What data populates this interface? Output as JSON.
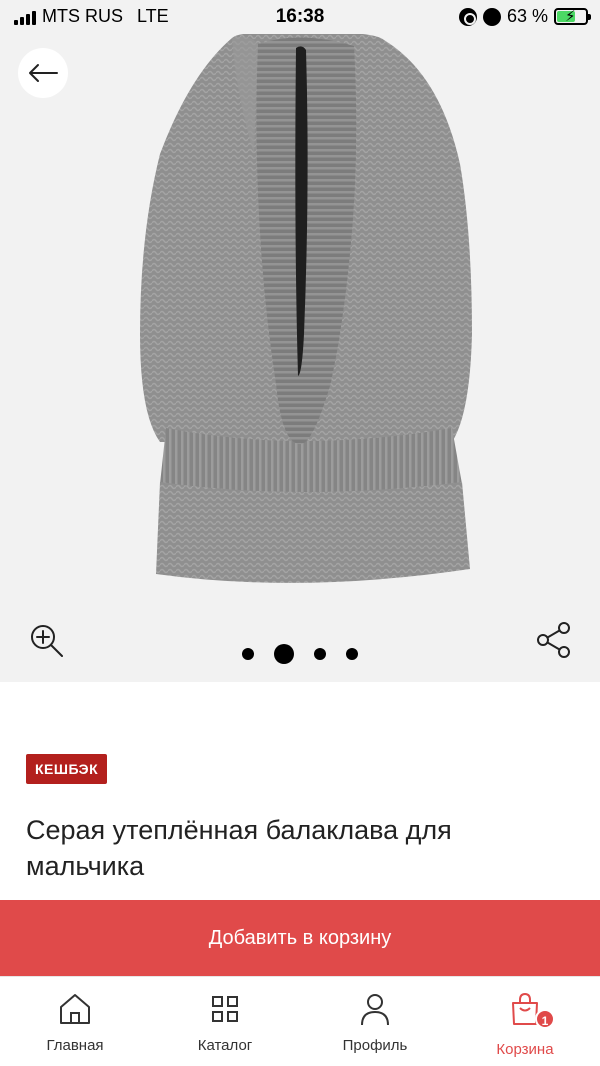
{
  "status_bar": {
    "carrier": "MTS RUS",
    "network": "LTE",
    "time": "16:38",
    "battery": "63 %",
    "battery_level": 0.63
  },
  "gallery": {
    "image_count": 4,
    "active_index": 1
  },
  "product": {
    "badge": "КЕШБЭК",
    "title": "Серая утеплённая балаклава для мальчика"
  },
  "add_to_cart_label": "Добавить в корзину",
  "tab_bar": {
    "home": "Главная",
    "catalog": "Каталог",
    "profile": "Профиль",
    "cart": "Корзина",
    "cart_count": "1"
  },
  "colors": {
    "accent": "#e04a4a",
    "badge": "#b3201d",
    "gallery_bg": "#f2f2f2"
  }
}
